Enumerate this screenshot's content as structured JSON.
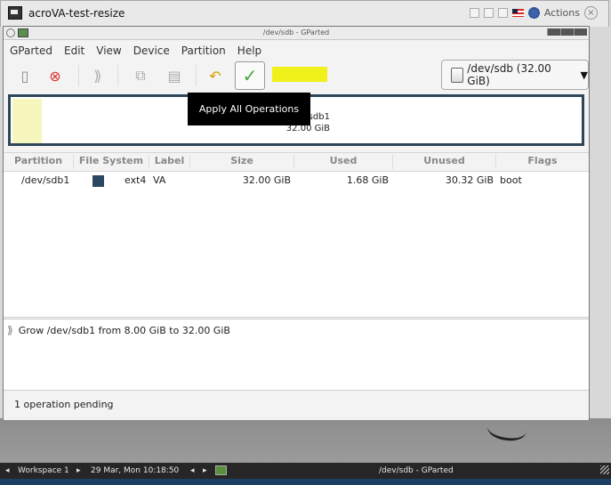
{
  "outer_window": {
    "title": "acroVA-test-resize",
    "actions_label": "Actions"
  },
  "gparted": {
    "title": "/dev/sdb - GParted",
    "menu": [
      "GParted",
      "Edit",
      "View",
      "Device",
      "Partition",
      "Help"
    ],
    "device_selector": "/dev/sdb (32.00 GiB)",
    "tooltip": "Apply All Operations",
    "disk_map": {
      "partition_label": "/dev/sdb1",
      "size_label": "32.00 GiB"
    },
    "columns": [
      "Partition",
      "File System",
      "Label",
      "Size",
      "Used",
      "Unused",
      "Flags"
    ],
    "rows": [
      {
        "partition": "/dev/sdb1",
        "file_system": "ext4",
        "label": "VA",
        "size": "32.00 GiB",
        "used": "1.68 GiB",
        "unused": "30.32 GiB",
        "flags": "boot"
      }
    ],
    "operations": [
      "Grow /dev/sdb1 from 8.00 GiB to 32.00 GiB"
    ],
    "status": "1 operation pending"
  },
  "taskbar": {
    "workspace": "Workspace 1",
    "datetime": "29 Mar, Mon 10:18:50",
    "active_window": "/dev/sdb - GParted"
  },
  "colors": {
    "highlight": "#f0f01a",
    "disk_border": "#2e4659",
    "ext4": "#2d4661",
    "apply_check": "#48a63d",
    "taskbar": "#262626"
  }
}
